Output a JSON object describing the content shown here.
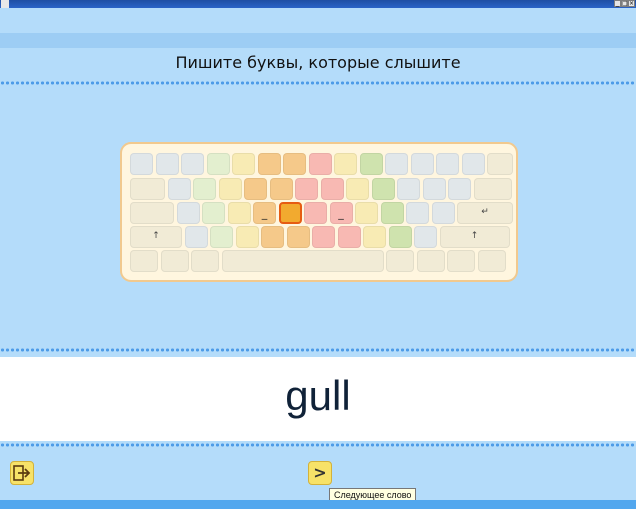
{
  "window": {
    "buttons": [
      "_",
      "□",
      "×"
    ]
  },
  "instruction": "Пишите буквы, которые слышите",
  "keyboard": {
    "colors": {
      "gray": "#e1e7ea",
      "green_light": "#e3efcf",
      "green": "#cfe3ae",
      "yellow": "#f8ebb4",
      "orange": "#f5c98a",
      "pink": "#f8b9b3",
      "cream": "#f1ebd6",
      "active": "#f2aa2f",
      "active_border": "#e65c12"
    },
    "rows": [
      [
        "gray",
        "gray",
        "gray",
        "green_light",
        "yellow",
        "orange",
        "orange",
        "pink",
        "yellow",
        "green",
        "gray",
        "gray",
        "gray",
        "gray",
        "cream"
      ],
      [
        "cream",
        "gray",
        "green_light",
        "yellow",
        "orange",
        "orange",
        "pink",
        "pink",
        "yellow",
        "green",
        "gray",
        "gray",
        "gray",
        "cream"
      ],
      [
        "cream",
        "gray",
        "green_light",
        "yellow",
        "orange",
        "active",
        "pink",
        "pink",
        "yellow",
        "green",
        "gray",
        "gray",
        "cream"
      ],
      [
        "cream",
        "gray",
        "green_light",
        "yellow",
        "orange",
        "orange",
        "pink",
        "pink",
        "yellow",
        "green",
        "gray",
        "cream"
      ],
      [
        "cream",
        "cream",
        "cream",
        "cream",
        "cream",
        "cream",
        "cream",
        "cream"
      ]
    ],
    "home_marks": [
      "_",
      "_"
    ],
    "enter_glyph": "↵",
    "shift_glyph": "↑"
  },
  "word": "gull",
  "footer": {
    "exit_icon": "exit-icon",
    "next_glyph": ">",
    "next_tooltip": "Следующее слово"
  }
}
